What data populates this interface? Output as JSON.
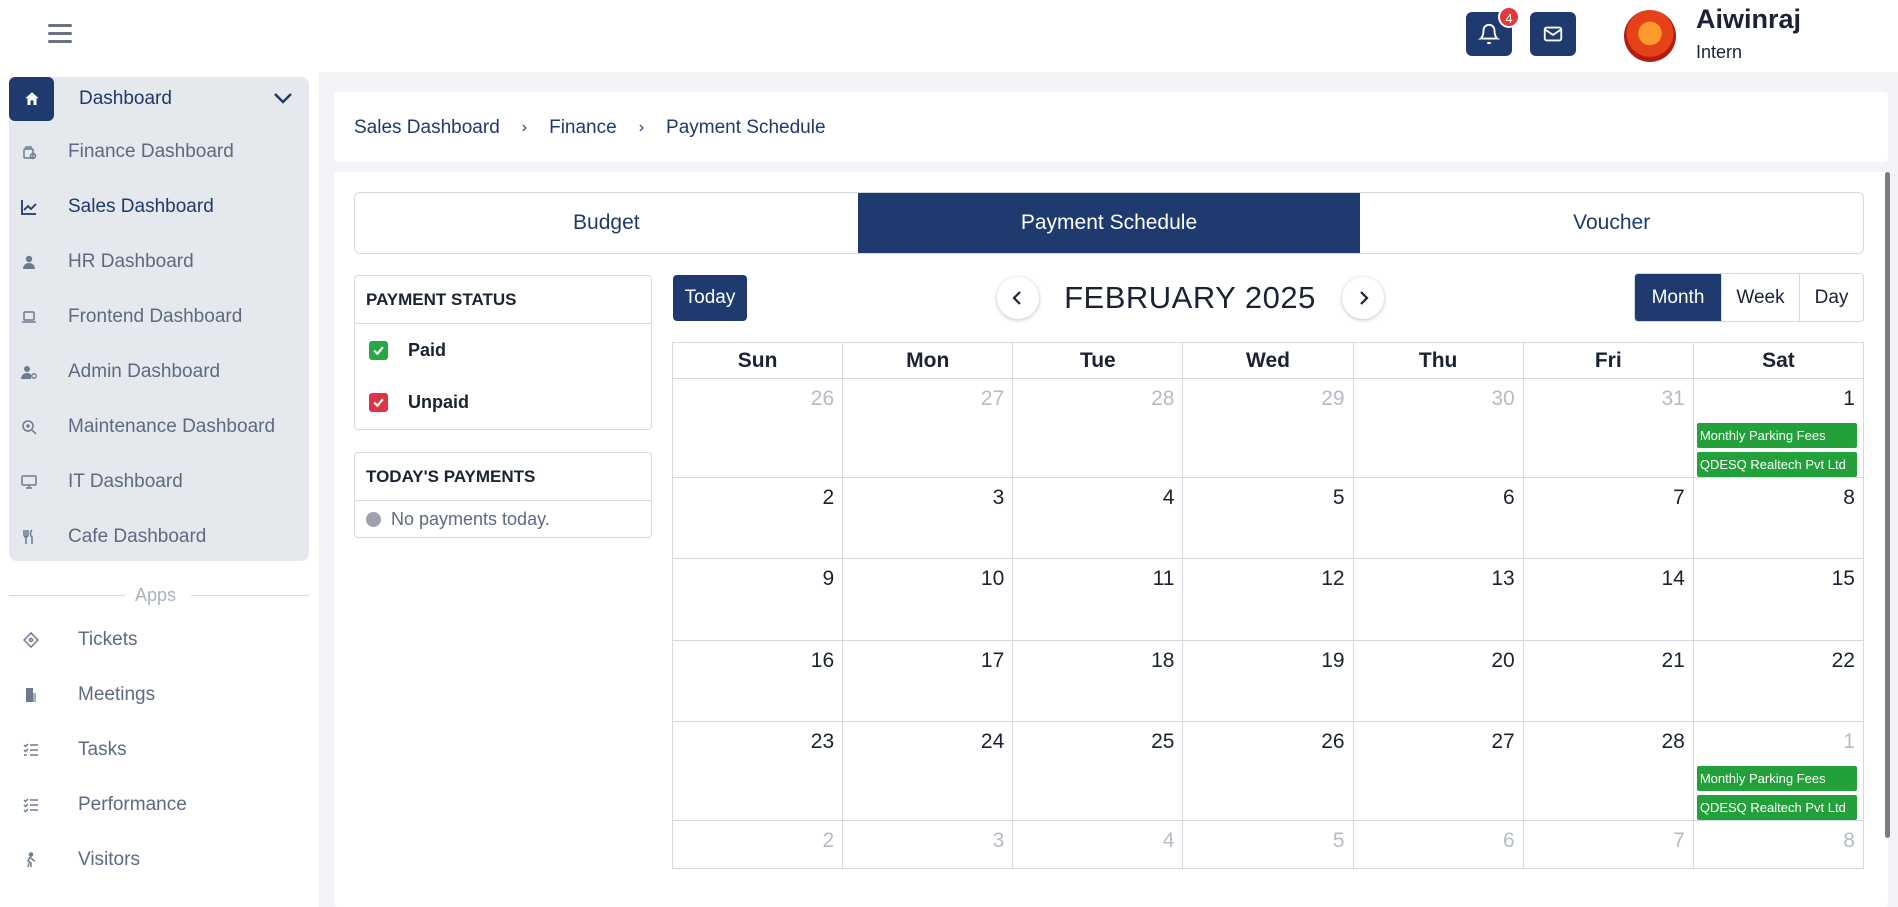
{
  "header": {
    "notification_count": "4",
    "user_name": "Aiwinraj",
    "user_role": "Intern"
  },
  "sidebar": {
    "group_title": "Dashboard",
    "items": [
      {
        "label": "Finance Dashboard",
        "icon": "finance-icon"
      },
      {
        "label": "Sales Dashboard",
        "icon": "chart-line-icon"
      },
      {
        "label": "HR Dashboard",
        "icon": "user-icon"
      },
      {
        "label": "Frontend Dashboard",
        "icon": "laptop-icon"
      },
      {
        "label": "Admin Dashboard",
        "icon": "user-gear-icon"
      },
      {
        "label": "Maintenance Dashboard",
        "icon": "wrench-search-icon"
      },
      {
        "label": "IT Dashboard",
        "icon": "monitor-icon"
      },
      {
        "label": "Cafe Dashboard",
        "icon": "utensils-icon"
      }
    ],
    "apps_label": "Apps",
    "apps": [
      {
        "label": "Tickets",
        "icon": "ticket-icon"
      },
      {
        "label": "Meetings",
        "icon": "building-icon"
      },
      {
        "label": "Tasks",
        "icon": "checklist-icon"
      },
      {
        "label": "Performance",
        "icon": "list-check-icon"
      },
      {
        "label": "Visitors",
        "icon": "walking-person-icon"
      }
    ]
  },
  "breadcrumb": [
    "Sales Dashboard",
    "Finance",
    "Payment Schedule"
  ],
  "tabs": [
    {
      "label": "Budget",
      "active": false
    },
    {
      "label": "Payment Schedule",
      "active": true
    },
    {
      "label": "Voucher",
      "active": false
    }
  ],
  "payment_status": {
    "title": "PAYMENT STATUS",
    "options": [
      {
        "label": "Paid",
        "color": "#28a745",
        "checked": true
      },
      {
        "label": "Unpaid",
        "color": "#dc3545",
        "checked": true
      }
    ]
  },
  "todays_payments": {
    "title": "TODAY'S PAYMENTS",
    "empty_text": "No payments today."
  },
  "calendar": {
    "today_label": "Today",
    "title": "FEBRUARY 2025",
    "views": [
      {
        "label": "Month",
        "active": true
      },
      {
        "label": "Week",
        "active": false
      },
      {
        "label": "Day",
        "active": false
      }
    ],
    "weekdays": [
      "Sun",
      "Mon",
      "Tue",
      "Wed",
      "Thu",
      "Fri",
      "Sat"
    ],
    "weeks": [
      [
        {
          "d": "26",
          "muted": true
        },
        {
          "d": "27",
          "muted": true
        },
        {
          "d": "28",
          "muted": true
        },
        {
          "d": "29",
          "muted": true
        },
        {
          "d": "30",
          "muted": true
        },
        {
          "d": "31",
          "muted": true
        },
        {
          "d": "1",
          "muted": false,
          "events": [
            "Monthly Parking Fees",
            "QDESQ Realtech Pvt Ltd"
          ]
        }
      ],
      [
        {
          "d": "2"
        },
        {
          "d": "3"
        },
        {
          "d": "4"
        },
        {
          "d": "5"
        },
        {
          "d": "6"
        },
        {
          "d": "7"
        },
        {
          "d": "8"
        }
      ],
      [
        {
          "d": "9"
        },
        {
          "d": "10"
        },
        {
          "d": "11"
        },
        {
          "d": "12"
        },
        {
          "d": "13"
        },
        {
          "d": "14"
        },
        {
          "d": "15"
        }
      ],
      [
        {
          "d": "16"
        },
        {
          "d": "17"
        },
        {
          "d": "18"
        },
        {
          "d": "19"
        },
        {
          "d": "20"
        },
        {
          "d": "21"
        },
        {
          "d": "22"
        }
      ],
      [
        {
          "d": "23"
        },
        {
          "d": "24"
        },
        {
          "d": "25"
        },
        {
          "d": "26"
        },
        {
          "d": "27"
        },
        {
          "d": "28"
        },
        {
          "d": "1",
          "muted": true,
          "events": [
            "Monthly Parking Fees",
            "QDESQ Realtech Pvt Ltd"
          ]
        }
      ],
      [
        {
          "d": "2",
          "muted": true
        },
        {
          "d": "3",
          "muted": true
        },
        {
          "d": "4",
          "muted": true
        },
        {
          "d": "5",
          "muted": true
        },
        {
          "d": "6",
          "muted": true
        },
        {
          "d": "7",
          "muted": true
        },
        {
          "d": "8",
          "muted": true
        }
      ]
    ],
    "event_color": "#22a13a"
  },
  "colors": {
    "primary": "#1e3a6e"
  }
}
